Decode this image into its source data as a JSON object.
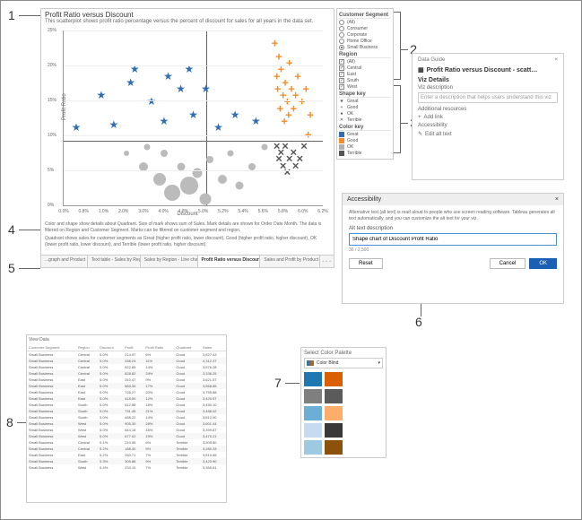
{
  "callouts": {
    "1": "1",
    "2": "2",
    "3": "3",
    "4": "4",
    "5": "5",
    "6": "6",
    "7": "7",
    "8": "8"
  },
  "viz": {
    "title": "Profit Ratio versus Discount",
    "subtitle": "This scatterplot shows profit ratio percentage versus the percent of discount for sales for all years in the data set.",
    "y_label": "Profit Ratio",
    "x_label": "Discount",
    "x_ticks": [
      "0.0%",
      "0.8%",
      "1.0%",
      "2.0%",
      "3.0%",
      "4.0%",
      "4.8%",
      "5.0%",
      "5.2%",
      "5.4%",
      "5.6%",
      "5.8%",
      "6.0%",
      "6.2%"
    ],
    "y_ticks": [
      "0%",
      "5%",
      "10%",
      "15%",
      "20%",
      "25%"
    ],
    "caption1": "Color and shape show details about Quadrant. Size of mark shows sum of Sales. Mark details are shown for Order Date Month. The data is filtered on Region and Customer Segment. Marks can be filtered on customer segment and region.",
    "caption2": "Quadrant shows sales for customer segments as Great (higher profit ratio, lower discount), Good (higher profit ratio, higher discount), OK (lower profit ratio, lower discount), and Terrible (lower profit ratio, higher discount).",
    "tabs": [
      "...graph and Product s...",
      "Text table - Sales by Region",
      "Sales by Region - Line chart ...",
      "Profit Ratio versus Discount - ...",
      "Sales and Profit by Product su..."
    ]
  },
  "chart_data": {
    "type": "scatter",
    "xlabel": "Discount",
    "ylabel": "Profit Ratio",
    "xlim": [
      0.0,
      6.2
    ],
    "ylim": [
      0,
      27
    ],
    "reference_lines": {
      "x": 5.0,
      "y": 10
    },
    "series": [
      {
        "name": "Great",
        "shape": "star",
        "color": "#2e6fb4",
        "points": [
          {
            "x": 0.3,
            "y": 12
          },
          {
            "x": 0.9,
            "y": 17
          },
          {
            "x": 1.2,
            "y": 12.5
          },
          {
            "x": 1.6,
            "y": 19
          },
          {
            "x": 1.7,
            "y": 21
          },
          {
            "x": 2.1,
            "y": 16
          },
          {
            "x": 2.4,
            "y": 13
          },
          {
            "x": 2.5,
            "y": 20
          },
          {
            "x": 2.8,
            "y": 18
          },
          {
            "x": 3.0,
            "y": 21
          },
          {
            "x": 3.1,
            "y": 14
          },
          {
            "x": 3.4,
            "y": 18
          },
          {
            "x": 3.7,
            "y": 12
          },
          {
            "x": 4.1,
            "y": 14
          },
          {
            "x": 4.6,
            "y": 13
          }
        ]
      },
      {
        "name": "Good",
        "shape": "plus",
        "color": "#f28e2b",
        "points": [
          {
            "x": 5.05,
            "y": 25
          },
          {
            "x": 5.1,
            "y": 20
          },
          {
            "x": 5.12,
            "y": 18
          },
          {
            "x": 5.15,
            "y": 23
          },
          {
            "x": 5.18,
            "y": 15
          },
          {
            "x": 5.2,
            "y": 21
          },
          {
            "x": 5.25,
            "y": 17
          },
          {
            "x": 5.28,
            "y": 13
          },
          {
            "x": 5.3,
            "y": 19
          },
          {
            "x": 5.35,
            "y": 16
          },
          {
            "x": 5.38,
            "y": 14
          },
          {
            "x": 5.4,
            "y": 22
          },
          {
            "x": 5.45,
            "y": 18
          },
          {
            "x": 5.5,
            "y": 15
          },
          {
            "x": 5.55,
            "y": 17
          },
          {
            "x": 5.6,
            "y": 20
          },
          {
            "x": 5.7,
            "y": 16
          },
          {
            "x": 5.8,
            "y": 18
          },
          {
            "x": 5.9,
            "y": 14
          },
          {
            "x": 5.85,
            "y": 11
          }
        ]
      },
      {
        "name": "OK",
        "shape": "circle",
        "color": "#b0b0b0",
        "points": [
          {
            "x": 1.5,
            "y": 8,
            "size": 6
          },
          {
            "x": 1.9,
            "y": 6,
            "size": 10
          },
          {
            "x": 2.0,
            "y": 9,
            "size": 7
          },
          {
            "x": 2.3,
            "y": 4,
            "size": 14
          },
          {
            "x": 2.4,
            "y": 8,
            "size": 8
          },
          {
            "x": 2.6,
            "y": 2,
            "size": 18
          },
          {
            "x": 2.8,
            "y": 6,
            "size": 9
          },
          {
            "x": 3.0,
            "y": 3,
            "size": 20
          },
          {
            "x": 3.2,
            "y": 5,
            "size": 11
          },
          {
            "x": 3.4,
            "y": 1,
            "size": 13
          },
          {
            "x": 3.5,
            "y": 7,
            "size": 8
          },
          {
            "x": 3.8,
            "y": 4,
            "size": 10
          },
          {
            "x": 4.0,
            "y": 8,
            "size": 7
          },
          {
            "x": 4.2,
            "y": 3,
            "size": 9
          },
          {
            "x": 4.5,
            "y": 6,
            "size": 8
          },
          {
            "x": 4.8,
            "y": 9,
            "size": 7
          }
        ]
      },
      {
        "name": "Terrible",
        "shape": "x",
        "color": "#555555",
        "points": [
          {
            "x": 5.1,
            "y": 9
          },
          {
            "x": 5.15,
            "y": 7
          },
          {
            "x": 5.2,
            "y": 8
          },
          {
            "x": 5.25,
            "y": 6
          },
          {
            "x": 5.3,
            "y": 9
          },
          {
            "x": 5.35,
            "y": 5
          },
          {
            "x": 5.4,
            "y": 7
          },
          {
            "x": 5.5,
            "y": 8
          },
          {
            "x": 5.55,
            "y": 6
          },
          {
            "x": 5.65,
            "y": 7
          },
          {
            "x": 5.75,
            "y": 9
          }
        ]
      }
    ]
  },
  "legend": {
    "segment_title": "Customer Segment",
    "segments": [
      {
        "label": "(All)",
        "on": false
      },
      {
        "label": "Consumer",
        "on": false
      },
      {
        "label": "Corporate",
        "on": false
      },
      {
        "label": "Home Office",
        "on": false
      },
      {
        "label": "Small Business",
        "on": true
      }
    ],
    "region_title": "Region",
    "regions": [
      {
        "label": "(All)",
        "on": true
      },
      {
        "label": "Central",
        "on": true
      },
      {
        "label": "East",
        "on": true
      },
      {
        "label": "South",
        "on": true
      },
      {
        "label": "West",
        "on": true
      }
    ],
    "shape_title": "Shape key",
    "shapes": [
      {
        "sym": "★",
        "label": "Great"
      },
      {
        "sym": "+",
        "label": "Good"
      },
      {
        "sym": "●",
        "label": "OK"
      },
      {
        "sym": "✕",
        "label": "Terrible"
      }
    ],
    "color_title": "Color key",
    "colors": [
      {
        "c": "#2e6fb4",
        "label": "Great"
      },
      {
        "c": "#f28e2b",
        "label": "Good"
      },
      {
        "c": "#b0b0b0",
        "label": "OK"
      },
      {
        "c": "#555555",
        "label": "Terrible"
      }
    ]
  },
  "guide": {
    "header": "Data Guide",
    "title": "Profit Ratio versus Discount - scatt…",
    "section": "Viz Details",
    "desc_label": "Viz description",
    "desc_placeholder": "Enter a description that helps users understand this viz",
    "resources_label": "Additional resources",
    "add_link": "Add link",
    "acc_label": "Accessibility",
    "edit_alt": "Edit alt text"
  },
  "acc": {
    "title": "Accessibility",
    "desc": "Alternative text (alt text) is read aloud to people who use screen reading software. Tableau generates alt text automatically, and you can customize the alt text for your viz.",
    "field_label": "Alt text description",
    "value": "Shape chart of Discount Profit Ratio",
    "counter": "36 / 2,500",
    "reset": "Reset",
    "cancel": "Cancel",
    "ok": "OK"
  },
  "palette": {
    "title": "Select Color Palette",
    "selected": "Color Blind",
    "swatches": [
      "#1f77b4",
      "#d95f02",
      "#7f7f7f",
      "#5b5b5b",
      "#6baed6",
      "#fdae6b",
      "#c6dbef",
      "#393939",
      "#9ecae1",
      "#8c510a"
    ]
  },
  "table": {
    "view_label": "View Data",
    "headers": [
      "Customer Segment",
      "Region",
      "Discount",
      "Profit",
      "Profit Ratio",
      "Quadrant",
      "Sales"
    ],
    "rows": [
      [
        "Small Business",
        "Central",
        "5.0%",
        "214.97",
        "6%",
        "Good",
        "3,827.43"
      ],
      [
        "Small Business",
        "Central",
        "5.0%",
        "338.24",
        "11%",
        "Good",
        "4,312.37"
      ],
      [
        "Small Business",
        "Central",
        "5.0%",
        "522.65",
        "14%",
        "Good",
        "3,576.28"
      ],
      [
        "Small Business",
        "Central",
        "5.0%",
        "828.82",
        "24%",
        "Good",
        "3,336.25"
      ],
      [
        "Small Business",
        "East",
        "5.0%",
        "310.47",
        "9%",
        "Good",
        "3,621.57"
      ],
      [
        "Small Business",
        "East",
        "5.0%",
        "583.30",
        "17%",
        "Good",
        "3,568.85"
      ],
      [
        "Small Business",
        "East",
        "5.0%",
        "726.27",
        "20%",
        "Good",
        "3,755.88"
      ],
      [
        "Small Business",
        "East",
        "5.0%",
        "418.50",
        "12%",
        "Good",
        "3,420.57"
      ],
      [
        "Small Business",
        "South",
        "5.0%",
        "612.88",
        "18%",
        "Good",
        "3,450.10"
      ],
      [
        "Small Business",
        "South",
        "5.0%",
        "731.45",
        "21%",
        "Good",
        "3,488.02"
      ],
      [
        "Small Business",
        "South",
        "5.0%",
        "488.22",
        "14%",
        "Good",
        "3,512.90"
      ],
      [
        "Small Business",
        "West",
        "5.0%",
        "905.30",
        "26%",
        "Good",
        "3,601.44"
      ],
      [
        "Small Business",
        "West",
        "5.0%",
        "544.18",
        "16%",
        "Good",
        "3,399.87"
      ],
      [
        "Small Business",
        "West",
        "5.0%",
        "677.02",
        "19%",
        "Good",
        "3,470.21"
      ],
      [
        "Small Business",
        "Central",
        "5.1%",
        "210.55",
        "6%",
        "Terrible",
        "3,305.80"
      ],
      [
        "Small Business",
        "Central",
        "5.2%",
        "188.40",
        "5%",
        "Terrible",
        "3,280.33"
      ],
      [
        "Small Business",
        "East",
        "5.2%",
        "260.71",
        "7%",
        "Terrible",
        "3,510.65"
      ],
      [
        "Small Business",
        "South",
        "5.3%",
        "305.88",
        "9%",
        "Terrible",
        "3,420.90"
      ],
      [
        "Small Business",
        "West",
        "5.4%",
        "233.10",
        "7%",
        "Terrible",
        "3,355.61"
      ]
    ]
  }
}
